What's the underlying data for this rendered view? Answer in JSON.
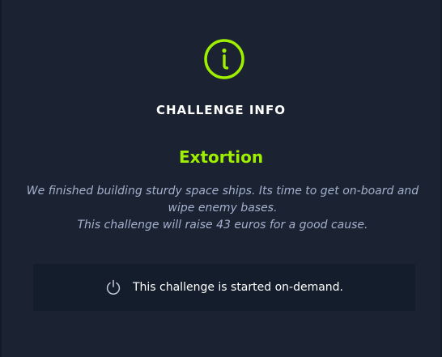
{
  "header": {
    "icon": "info-circle-icon",
    "heading": "CHALLENGE INFO"
  },
  "challenge": {
    "name": "Extortion",
    "description_line1": "We finished building sturdy space ships. Its time to get on-board and wipe enemy bases.",
    "description_line2": "This challenge will raise 43 euros for a good cause."
  },
  "status": {
    "icon": "power-icon",
    "text": "This challenge is started on-demand."
  },
  "colors": {
    "background": "#1b2333",
    "accent": "#9fef00",
    "muted_text": "#a4b1cd",
    "status_box": "#141d2b"
  }
}
